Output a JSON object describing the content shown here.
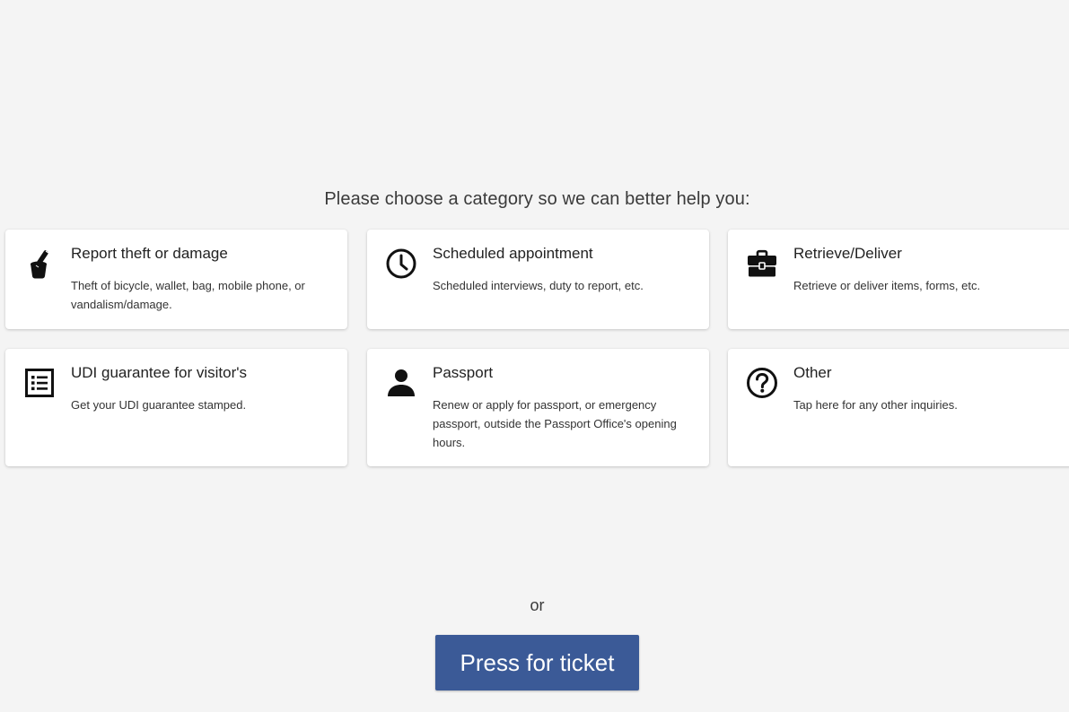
{
  "prompt": "Please choose a category so we can better help you:",
  "categories": [
    {
      "title": "Report theft or damage",
      "description": "Theft of bicycle, wallet, bag, mobile phone, or vandalism/damage.",
      "icon": "pen-in-cup-icon"
    },
    {
      "title": "Scheduled appointment",
      "description": "Scheduled interviews, duty to report, etc.",
      "icon": "clock-icon"
    },
    {
      "title": "Retrieve/Deliver",
      "description": "Retrieve or deliver items, forms, etc.",
      "icon": "briefcase-icon"
    },
    {
      "title": "UDI guarantee for visitor's",
      "description": "Get your UDI guarantee stamped.",
      "icon": "list-document-icon"
    },
    {
      "title": "Passport",
      "description": "Renew or apply for passport, or emergency passport, outside the Passport Office's opening hours.",
      "icon": "person-icon"
    },
    {
      "title": "Other",
      "description": "Tap here for any other inquiries.",
      "icon": "question-circle-icon"
    }
  ],
  "or_label": "or",
  "ticket_button_label": "Press for ticket",
  "colors": {
    "background": "#f4f4f4",
    "card": "#ffffff",
    "button": "#3b5a97",
    "button_text": "#ffffff"
  }
}
